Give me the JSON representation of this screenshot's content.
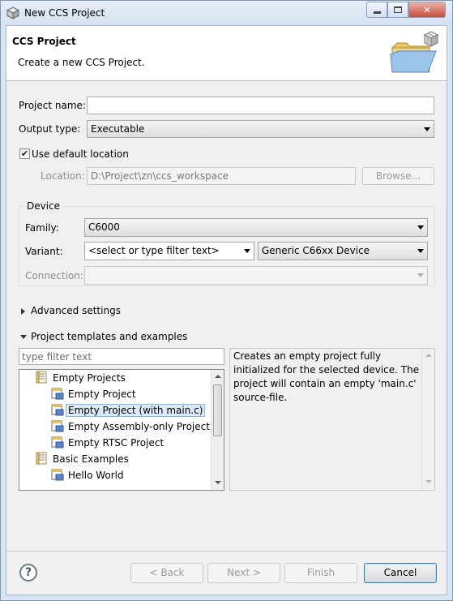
{
  "window": {
    "title": "New CCS Project"
  },
  "banner": {
    "heading": "CCS Project",
    "description": "Create a new CCS Project."
  },
  "form": {
    "project_name_label": "Project name:",
    "project_name_value": "",
    "output_type_label": "Output type:",
    "output_type_value": "Executable",
    "use_default_location_label": "Use default location",
    "use_default_location_checked": true,
    "location_label": "Location:",
    "location_value": "D:\\Project\\zn\\ccs_workspace",
    "browse_label": "Browse..."
  },
  "device": {
    "group_label": "Device",
    "family_label": "Family:",
    "family_value": "C6000",
    "variant_label": "Variant:",
    "variant_filter_placeholder": "<select or type filter text>",
    "variant_value": "Generic C66xx Device",
    "connection_label": "Connection:",
    "connection_value": ""
  },
  "advanced_settings": {
    "label": "Advanced settings",
    "expanded": false
  },
  "templates": {
    "label": "Project templates and examples",
    "expanded": true,
    "filter_placeholder": "type filter text",
    "tree": [
      {
        "label": "Empty Projects",
        "level": 1,
        "icon": "folder-list-icon"
      },
      {
        "label": "Empty Project",
        "level": 2,
        "icon": "project-template-icon"
      },
      {
        "label": "Empty Project (with main.c)",
        "level": 2,
        "icon": "project-template-icon",
        "selected": true
      },
      {
        "label": "Empty Assembly-only Project",
        "level": 2,
        "icon": "project-template-icon"
      },
      {
        "label": "Empty RTSC Project",
        "level": 2,
        "icon": "project-template-icon"
      },
      {
        "label": "Basic Examples",
        "level": 1,
        "icon": "folder-list-icon"
      },
      {
        "label": "Hello World",
        "level": 2,
        "icon": "project-template-icon"
      }
    ],
    "description": "Creates an empty project fully initialized for the selected device. The project will contain an empty 'main.c' source-file."
  },
  "buttons": {
    "back": "< Back",
    "next": "Next >",
    "finish": "Finish",
    "cancel": "Cancel"
  },
  "icons": {
    "help": "help-icon",
    "help_glyph": "?"
  }
}
